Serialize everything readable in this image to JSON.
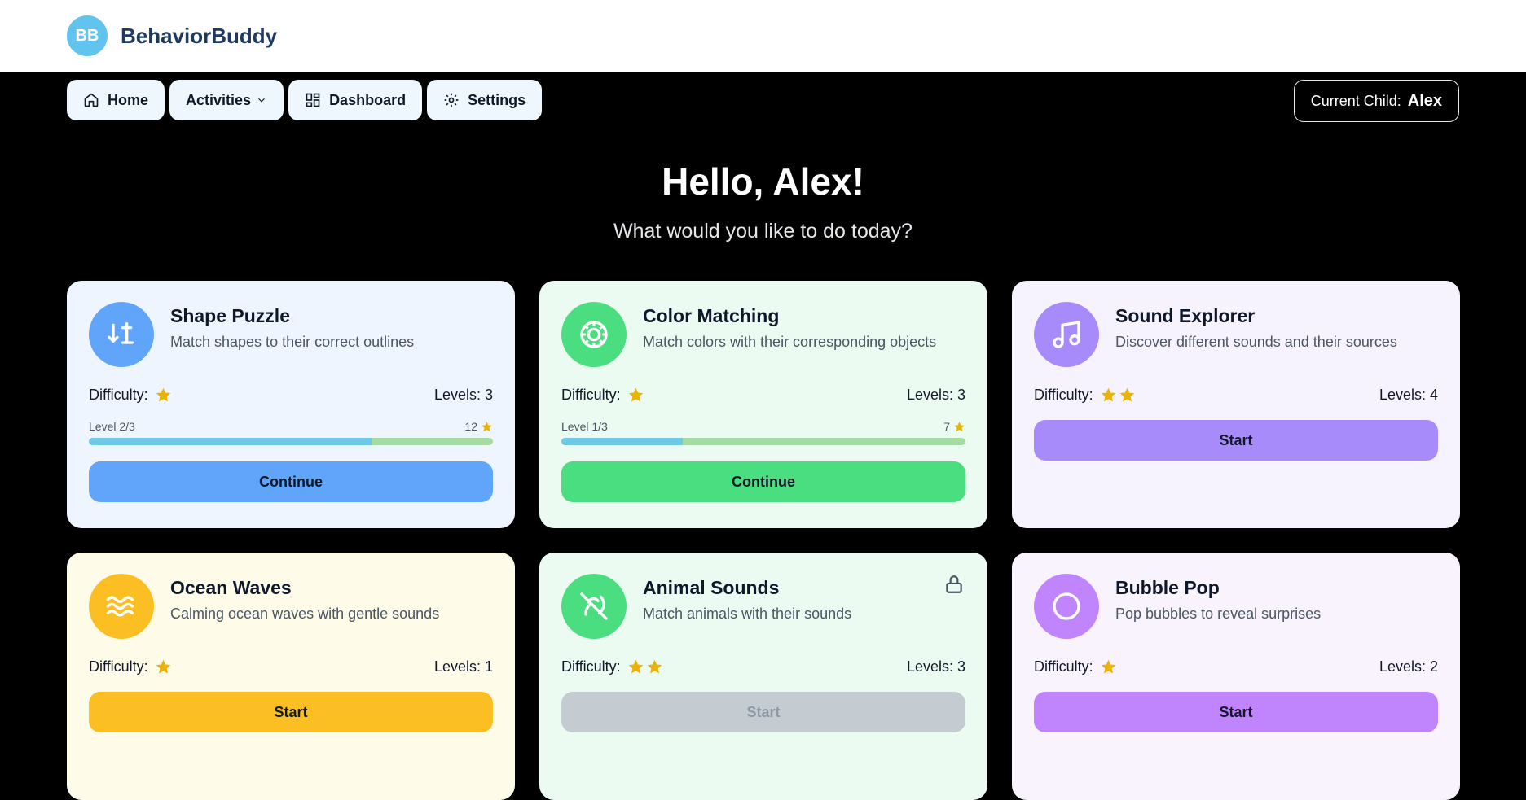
{
  "app": {
    "logo_initials": "BB",
    "name": "BehaviorBuddy"
  },
  "nav": {
    "home": "Home",
    "activities": "Activities",
    "dashboard": "Dashboard",
    "settings": "Settings"
  },
  "current_child": {
    "label": "Current Child:",
    "name": "Alex"
  },
  "hero": {
    "greeting": "Hello, Alex!",
    "subtitle": "What would you like to do today?"
  },
  "labels": {
    "difficulty": "Difficulty:"
  },
  "cards": [
    {
      "title": "Shape Puzzle",
      "desc": "Match shapes to their correct outlines",
      "difficulty": 1,
      "levels": "Levels: 3",
      "progress_label": "Level 2/3",
      "points": "12",
      "progress": 0.7,
      "button": "Continue",
      "bg": "#eef5fe",
      "accent": "#60a5fa",
      "icon": "shapes-icon",
      "locked": false
    },
    {
      "title": "Color Matching",
      "desc": "Match colors with their corresponding objects",
      "difficulty": 1,
      "levels": "Levels: 3",
      "progress_label": "Level 1/3",
      "points": "7",
      "progress": 0.3,
      "button": "Continue",
      "bg": "#ecfbf2",
      "accent": "#4ade80",
      "icon": "palette-icon",
      "locked": false
    },
    {
      "title": "Sound Explorer",
      "desc": "Discover different sounds and their sources",
      "difficulty": 2,
      "levels": "Levels: 4",
      "button": "Start",
      "bg": "#f7f3fe",
      "accent": "#a78bfa",
      "icon": "music-icon",
      "locked": false
    },
    {
      "title": "Ocean Waves",
      "desc": "Calming ocean waves with gentle sounds",
      "difficulty": 1,
      "levels": "Levels: 1",
      "button": "Start",
      "bg": "#fefbe9",
      "accent": "#fbbf24",
      "icon": "waves-icon",
      "locked": false
    },
    {
      "title": "Animal Sounds",
      "desc": "Match animals with their sounds",
      "difficulty": 2,
      "levels": "Levels: 3",
      "button": "Start",
      "bg": "#ecfbf2",
      "accent": "#4ade80",
      "icon": "ear-off-icon",
      "locked": true,
      "button_bg": "#c4ccd2"
    },
    {
      "title": "Bubble Pop",
      "desc": "Pop bubbles to reveal surprises",
      "difficulty": 1,
      "levels": "Levels: 2",
      "button": "Start",
      "bg": "#f9f3fe",
      "accent": "#c084fc",
      "icon": "circle-icon",
      "locked": false
    }
  ],
  "colors": {
    "star": "#eab308",
    "nav_bg": "#eef7fe"
  }
}
